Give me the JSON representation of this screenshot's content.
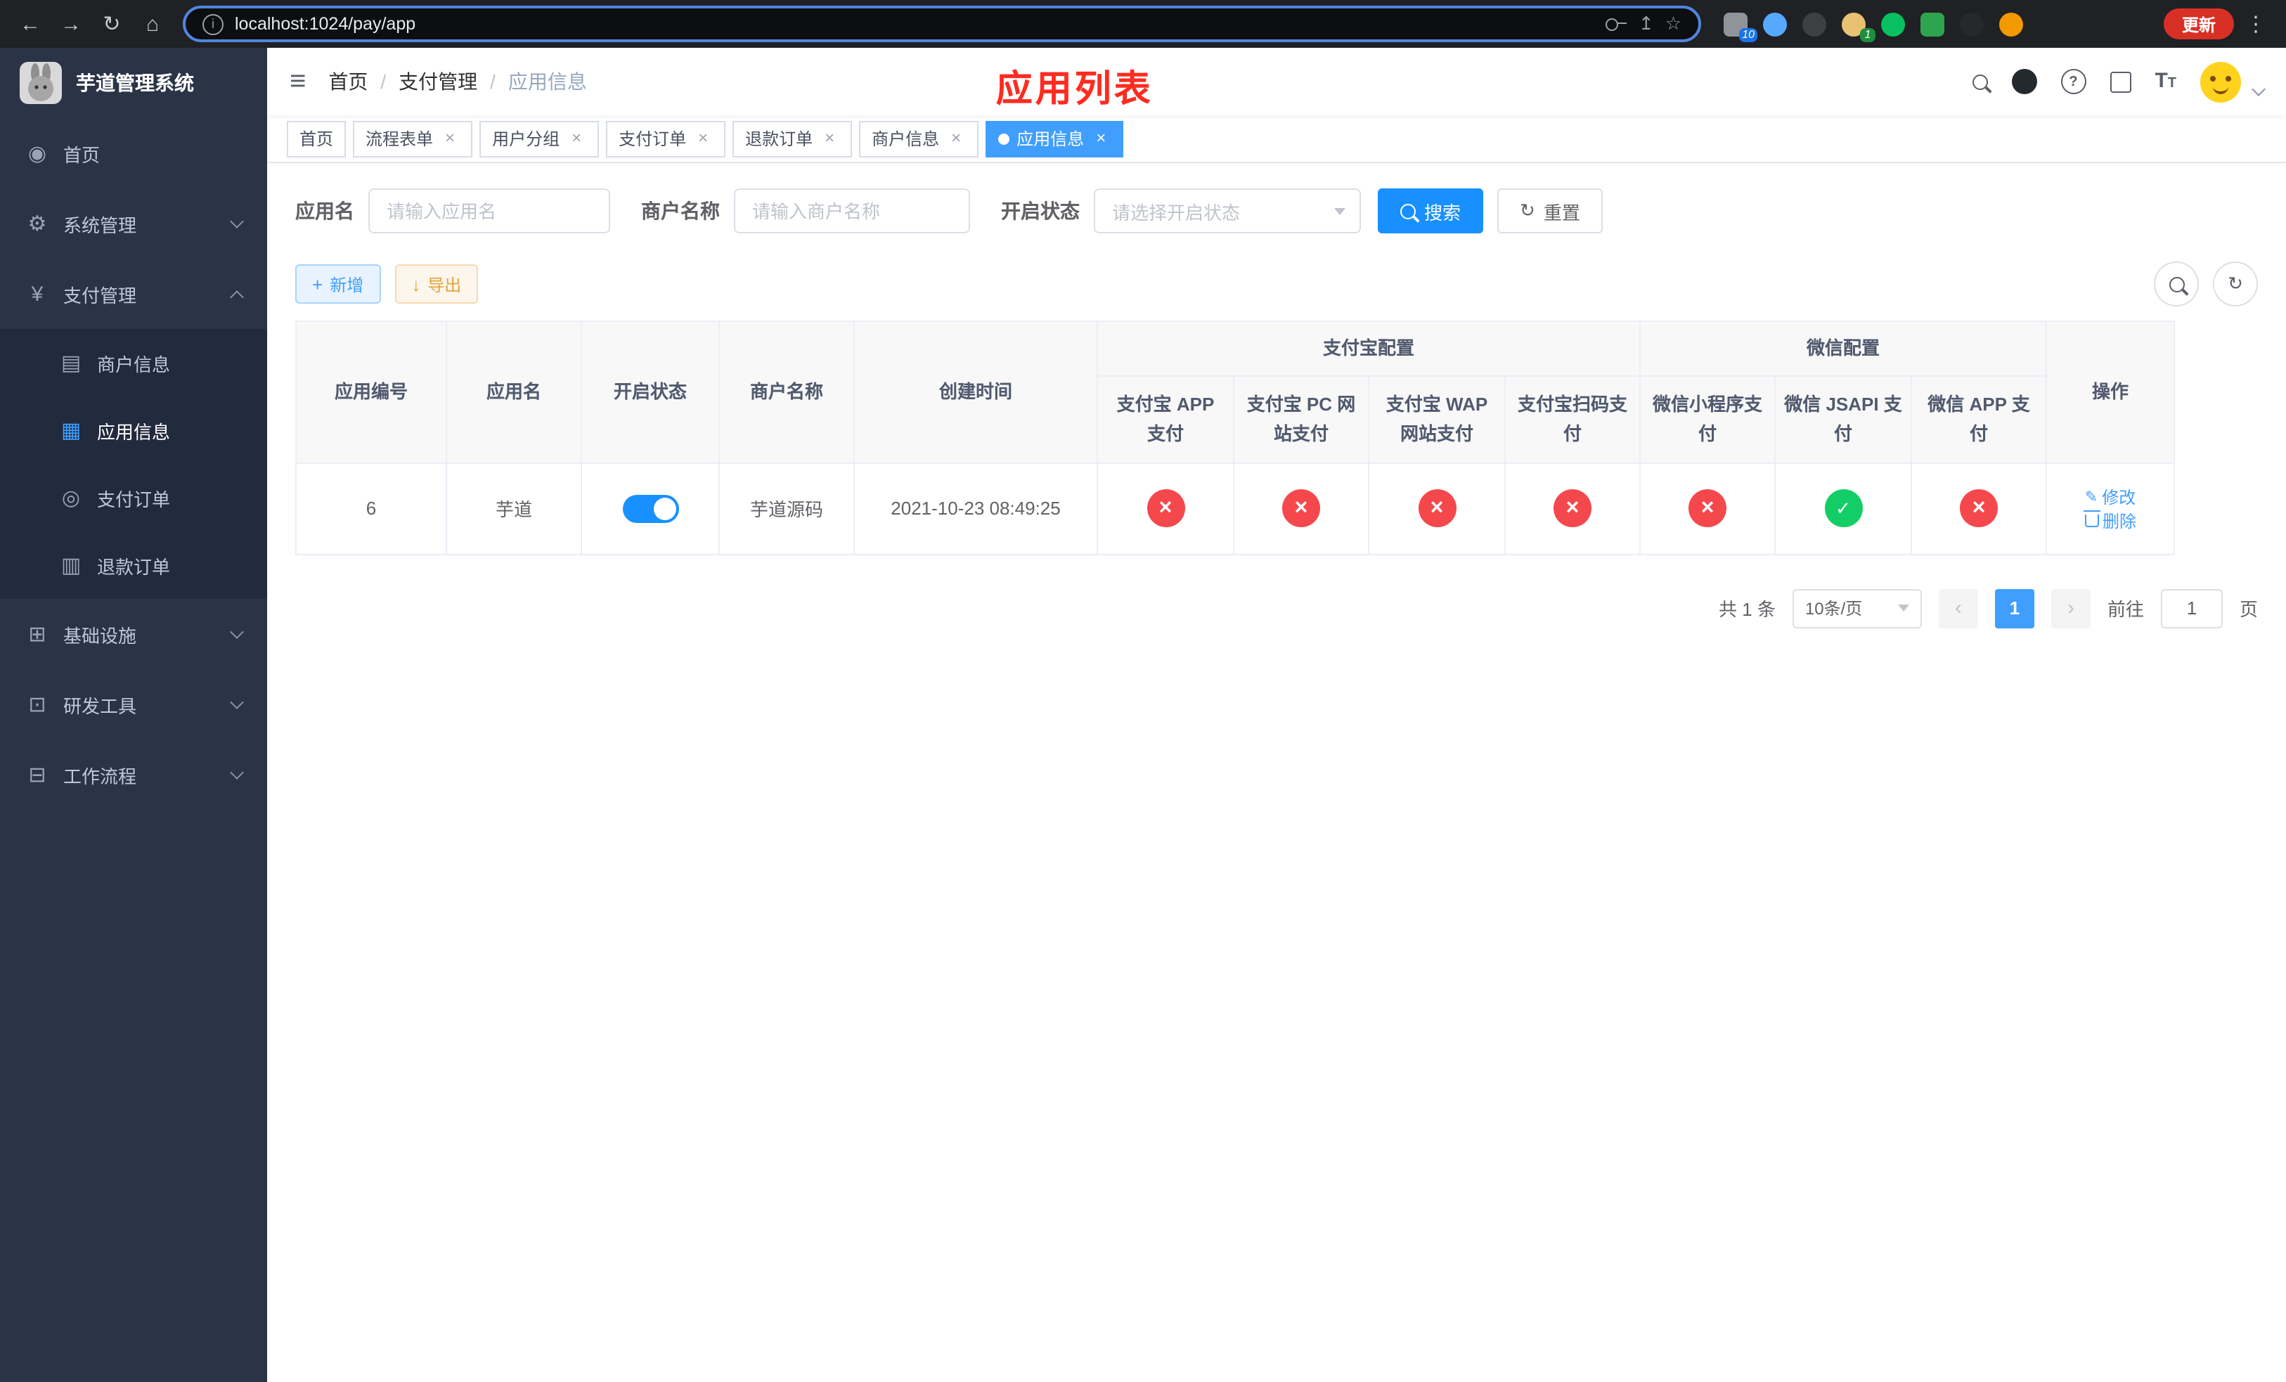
{
  "colors": {
    "primary": "#409eff",
    "search_button": "#1890ff",
    "title_red": "#fd2c20",
    "success_green": "#13ce66",
    "danger_red": "#f5484d",
    "warning_orange": "#e6a23c",
    "sidebar_bg": "#2b3447"
  },
  "icons": {
    "back": "←",
    "forward": "→",
    "reload": "↻",
    "home": "⌂",
    "share": "↥",
    "star": "☆",
    "kebab": "⋮",
    "hamburger": "≡",
    "close": "×",
    "plus": "+",
    "download": "↓",
    "refresh": "↻",
    "edit_pencil": "✎",
    "prev": "‹",
    "next": "›",
    "question": "?",
    "info": "i",
    "font_large": "T",
    "font_small": "T",
    "menu_dashboard": "◉",
    "menu_gear": "⚙",
    "menu_yen": "¥",
    "menu_card": "▤",
    "menu_grid": "▦",
    "menu_order": "◎",
    "menu_doc": "▥",
    "menu_infra": "⊞",
    "menu_tool": "⊡",
    "menu_flow": "⊟"
  },
  "browser": {
    "url": "localhost:1024/pay/app",
    "update_label": "更新",
    "ext_badge_a": "10",
    "ext_badge_b": "1"
  },
  "sidebar": {
    "app_title": "芋道管理系统",
    "home": "首页",
    "system": "系统管理",
    "pay": "支付管理",
    "merchant_info": "商户信息",
    "app_info": "应用信息",
    "pay_order": "支付订单",
    "refund_order": "退款订单",
    "infra": "基础设施",
    "dev_tools": "研发工具",
    "workflow": "工作流程"
  },
  "header": {
    "breadcrumb": [
      "首页",
      "支付管理",
      "应用信息"
    ],
    "breadcrumb_sep": "/",
    "page_title": "应用列表"
  },
  "tabs": [
    {
      "label": "首页"
    },
    {
      "label": "流程表单"
    },
    {
      "label": "用户分组"
    },
    {
      "label": "支付订单"
    },
    {
      "label": "退款订单"
    },
    {
      "label": "商户信息"
    },
    {
      "label": "应用信息"
    }
  ],
  "filters": {
    "app_name_label": "应用名",
    "app_name_placeholder": "请输入应用名",
    "merchant_label": "商户名称",
    "merchant_placeholder": "请输入商户名称",
    "status_label": "开启状态",
    "status_placeholder": "请选择开启状态",
    "search_label": "搜索",
    "reset_label": "重置"
  },
  "toolbar": {
    "add_label": "新增",
    "export_label": "导出"
  },
  "table": {
    "group_headers": {
      "alipay": "支付宝配置",
      "wechat": "微信配置"
    },
    "headers": {
      "app_id": "应用编号",
      "app_name": "应用名",
      "status": "开启状态",
      "merchant": "商户名称",
      "created": "创建时间",
      "alipay_app": "支付宝 APP 支付",
      "alipay_pc": "支付宝 PC 网站支付",
      "alipay_wap": "支付宝 WAP 网站支付",
      "alipay_qr": "支付宝扫码支付",
      "wx_mini": "微信小程序支付",
      "wx_jsapi": "微信 JSAPI 支付",
      "wx_app": "微信 APP 支付",
      "actions": "操作"
    },
    "row": {
      "app_id": "6",
      "app_name": "芋道",
      "status_on": "true",
      "merchant": "芋道源码",
      "created": "2021-10-23 08:49:25",
      "alipay_app": "no",
      "alipay_pc": "no",
      "alipay_wap": "no",
      "alipay_qr": "no",
      "wx_mini": "no",
      "wx_jsapi": "yes",
      "wx_app": "no",
      "edit_label": "修改",
      "delete_label": "删除"
    }
  },
  "pagination": {
    "total": "共 1 条",
    "page_size": "10条/页",
    "page": "1",
    "goto_prefix": "前往",
    "goto_value": "1",
    "goto_suffix": "页"
  }
}
